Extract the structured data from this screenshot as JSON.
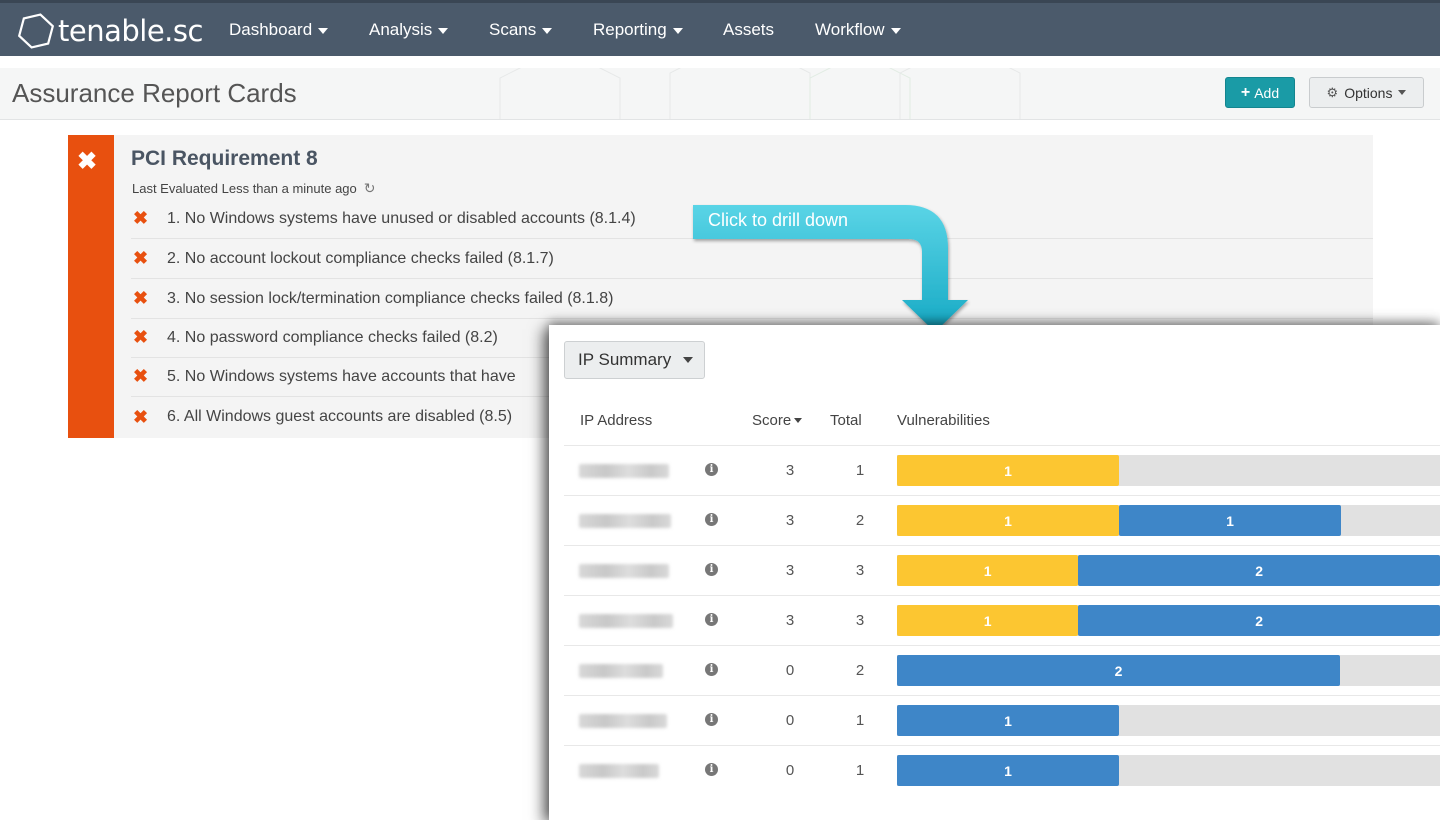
{
  "app": {
    "logo_text": "tenable.sc"
  },
  "nav": {
    "items": [
      {
        "label": "Dashboard",
        "dropdown": true
      },
      {
        "label": "Analysis",
        "dropdown": true
      },
      {
        "label": "Scans",
        "dropdown": true
      },
      {
        "label": "Reporting",
        "dropdown": true
      },
      {
        "label": "Assets",
        "dropdown": false
      },
      {
        "label": "Workflow",
        "dropdown": true
      }
    ]
  },
  "header": {
    "title": "Assurance Report Cards",
    "add_label": "Add",
    "options_label": "Options"
  },
  "card": {
    "title": "PCI Requirement 8",
    "evaluated": "Last Evaluated Less than a minute ago",
    "status": "failed",
    "items": [
      "1. No Windows systems have unused or disabled accounts (8.1.4)",
      "2. No account lockout compliance checks failed (8.1.7)",
      "3. No session lock/termination compliance checks failed (8.1.8)",
      "4. No password compliance checks failed (8.2)",
      "5. No Windows systems have accounts that have",
      "6. All Windows guest accounts are disabled (8.5)"
    ]
  },
  "callout": {
    "text": "Click to drill down"
  },
  "drilldown": {
    "tool": "IP Summary",
    "columns": {
      "ip": "IP Address",
      "score": "Score",
      "total": "Total",
      "vulns": "Vulnerabilities"
    },
    "bar_scale_max": 2.45,
    "rows": [
      {
        "score": "3",
        "total": "1",
        "medium": 1,
        "low": 0
      },
      {
        "score": "3",
        "total": "2",
        "medium": 1,
        "low": 1
      },
      {
        "score": "3",
        "total": "3",
        "medium": 1,
        "low": 2
      },
      {
        "score": "3",
        "total": "3",
        "medium": 1,
        "low": 2
      },
      {
        "score": "0",
        "total": "2",
        "medium": 0,
        "low": 2
      },
      {
        "score": "0",
        "total": "1",
        "medium": 0,
        "low": 1
      },
      {
        "score": "0",
        "total": "1",
        "medium": 0,
        "low": 1
      }
    ]
  },
  "colors": {
    "medium": "#fcc631",
    "low": "#3e86c8",
    "fail": "#e8500f",
    "accent": "#1a9ba6"
  }
}
